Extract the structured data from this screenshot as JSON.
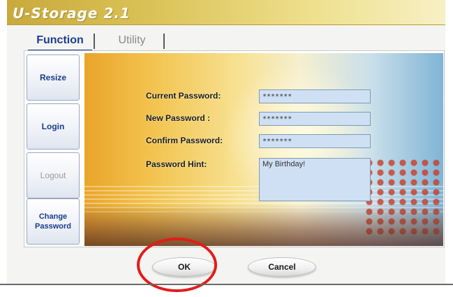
{
  "window": {
    "title": "U-Storage 2.1"
  },
  "tabs": [
    {
      "label": "Function",
      "active": true
    },
    {
      "label": "Utility",
      "active": false
    }
  ],
  "sidebar": {
    "items": [
      {
        "label": "Resize",
        "enabled": true
      },
      {
        "label": "Login",
        "enabled": true
      },
      {
        "label": "Logout",
        "enabled": false
      },
      {
        "label": "Change Password",
        "enabled": true
      }
    ]
  },
  "form": {
    "current_password_label": "Current Password:",
    "current_password_value": "*******",
    "new_password_label": "New Password :",
    "new_password_value": "*******",
    "confirm_password_label": "Confirm Password:",
    "confirm_password_value": "*******",
    "hint_label": "Password Hint:",
    "hint_value": "My Birthday!"
  },
  "buttons": {
    "ok": "OK",
    "cancel": "Cancel"
  },
  "colors": {
    "accent": "#1b3c8c",
    "title_bar": "#dcc45a",
    "field_background": "#cfe0f4",
    "annotation_ring": "#e41b1b"
  }
}
